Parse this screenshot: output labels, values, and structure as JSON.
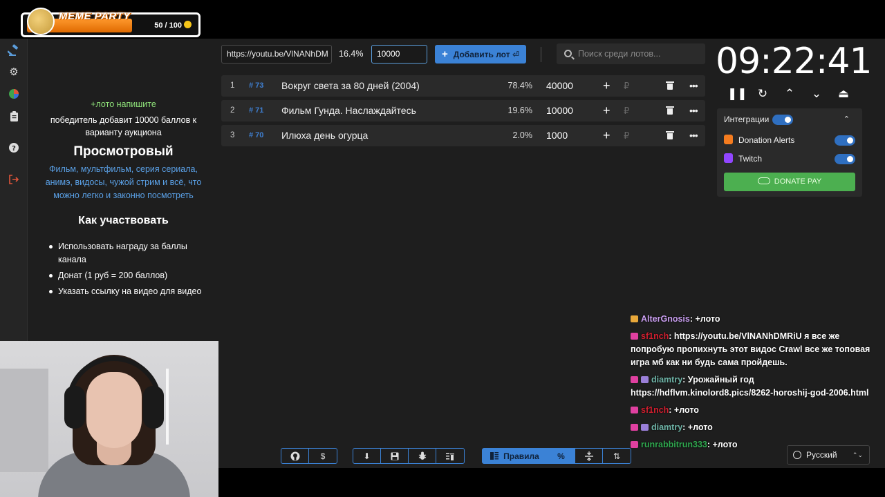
{
  "badge": {
    "title": "MEME PARTY",
    "count": "50 / 100"
  },
  "sidebar": {
    "icons": [
      "gavel-icon",
      "gear-icon",
      "pie-chart-icon",
      "clipboard-icon",
      "help-icon",
      "logout-icon"
    ]
  },
  "rules": {
    "green_line": "+лото напишите",
    "intro": "победитель добавит 10000 баллов к варианту аукциона",
    "heading": "Просмотровый",
    "description": "Фильм, мультфильм, серия сериала, анимэ, видосы, чужой стрим и всё, что можно легко и законно посмотреть",
    "how_heading": "Как участвовать",
    "items": [
      "Использовать награду за баллы канала",
      "Донат (1 руб = 200 баллов)",
      "Указать ссылку на видео для видео"
    ]
  },
  "toolbar": {
    "url_value": "https://youtu.be/VlNANhDM",
    "percent": "16.4%",
    "amount_value": "10000",
    "add_label": "Добавить лот ⏎",
    "search_placeholder": "Поиск среди лотов..."
  },
  "lots": [
    {
      "index": "1",
      "id": "# 73",
      "name": "Вокруг света за 80 дней (2004)",
      "percent": "78.4%",
      "amount": "40000"
    },
    {
      "index": "2",
      "id": "# 71",
      "name": "Фильм Гунда. Наслаждайтесь",
      "percent": "19.6%",
      "amount": "10000"
    },
    {
      "index": "3",
      "id": "# 70",
      "name": "Илюха день огурца",
      "percent": "2.0%",
      "amount": "1000"
    }
  ],
  "currency_symbol": "₽",
  "timer": {
    "value": "09:22:41"
  },
  "integrations": {
    "label": "Интеграции",
    "donation_alerts": "Donation Alerts",
    "twitch": "Twitch",
    "donate_pay": "DONATE PAY"
  },
  "chat": [
    {
      "user": "AlterGnosis",
      "color": "#c99ef0",
      "text": ": +лото"
    },
    {
      "user": "sf1nch",
      "color": "#d21f2f",
      "text": ": https://youtu.be/VlNANhDMRiU я все же попробую пропихнуть этот видос Crawl все же топовая игра мб как ни будь сама пройдешь."
    },
    {
      "user": "diamtry",
      "color": "#6fb5a8",
      "text": ": Урожайный год https://hdflvm.kinolord8.pics/8262-horoshij-god-2006.html"
    },
    {
      "user": "sf1nch",
      "color": "#d21f2f",
      "text": ": +лото"
    },
    {
      "user": "diamtry",
      "color": "#6fb5a8",
      "text": ": +лото"
    },
    {
      "user": "runrabbitrun333",
      "color": "#2fa84f",
      "text": ": +лото"
    }
  ],
  "bottom_toolbar": {
    "rules_label": "Правила",
    "language": "Русский"
  },
  "colors": {
    "accent": "#3b82d6",
    "donate_green": "#4caf50",
    "panel": "#2a2a2a",
    "background": "#1e1e1e"
  }
}
